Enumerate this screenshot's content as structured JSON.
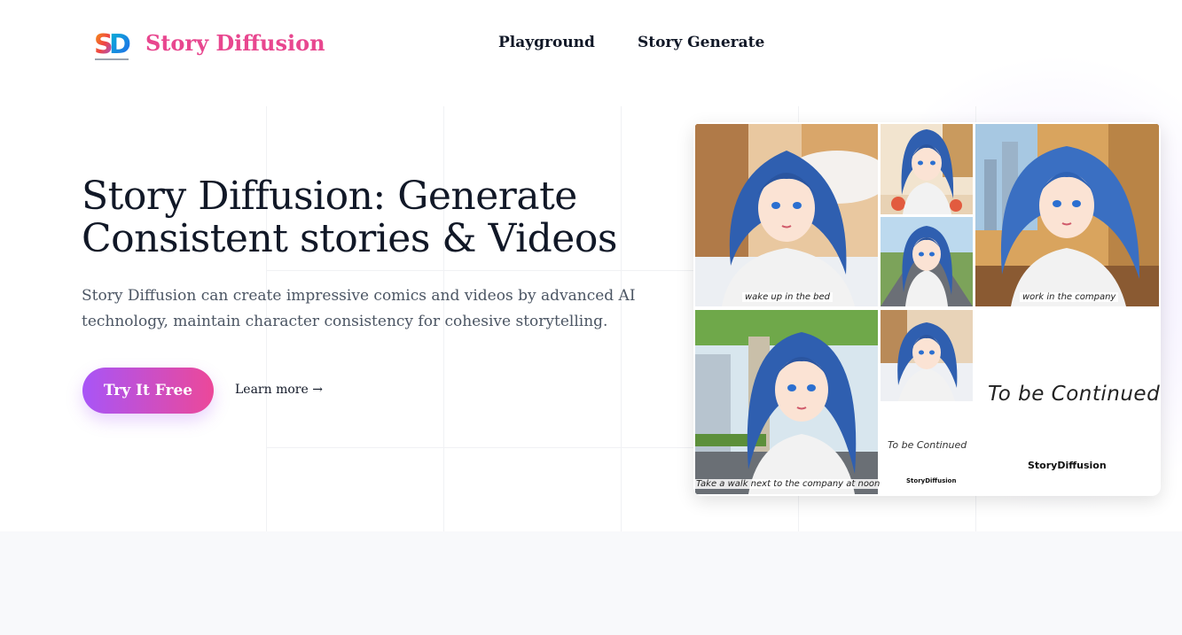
{
  "header": {
    "brand": "Story Diffusion",
    "nav": [
      "Playground",
      "Story Generate"
    ]
  },
  "hero": {
    "title": "Story Diffusion: Generate Consistent stories & Videos",
    "subtitle": "Story Diffusion can create impressive comics and videos by advanced AI technology, maintain character consistency for cohesive storytelling.",
    "cta_label": "Try It Free",
    "learn_more": "Learn more →"
  },
  "comic": {
    "captions": {
      "bed": "wake up in the bed",
      "company": "work in the company",
      "walk": "Take a walk next to the company at noon"
    },
    "to_be_continued_big": "To be Continued",
    "to_be_continued_small": "To be Continued",
    "watermark": "StoryDiffusion"
  },
  "colors": {
    "brand": "#e8478f",
    "cta_start": "#a855f7",
    "cta_end": "#ec4899",
    "hair": "#2f5fb0"
  }
}
